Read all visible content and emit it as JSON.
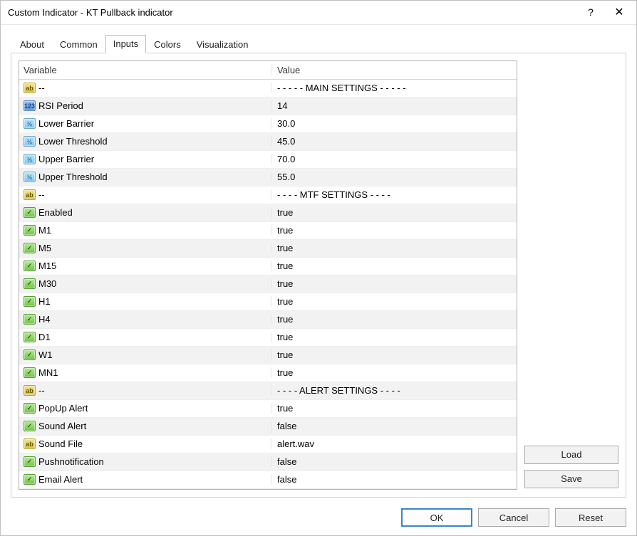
{
  "window": {
    "title": "Custom Indicator - KT Pullback indicator"
  },
  "tabs": [
    "About",
    "Common",
    "Inputs",
    "Colors",
    "Visualization"
  ],
  "active_tab": "Inputs",
  "columns": {
    "variable": "Variable",
    "value": "Value"
  },
  "sidebar": {
    "load": "Load",
    "save": "Save"
  },
  "footer": {
    "ok": "OK",
    "cancel": "Cancel",
    "reset": "Reset"
  },
  "iconLabels": {
    "text": "ab",
    "int": "123",
    "dbl": "½",
    "bool": "✓"
  },
  "rows": [
    {
      "icon": "text",
      "variable": "--",
      "value": "- - - - - MAIN SETTINGS - - - - -",
      "shade": "plain"
    },
    {
      "icon": "int",
      "variable": "RSI Period",
      "value": "14",
      "shade": "striped"
    },
    {
      "icon": "dbl",
      "variable": "Lower Barrier",
      "value": "30.0",
      "shade": "plain"
    },
    {
      "icon": "dbl",
      "variable": "Lower Threshold",
      "value": "45.0",
      "shade": "striped"
    },
    {
      "icon": "dbl",
      "variable": "Upper Barrier",
      "value": "70.0",
      "shade": "plain"
    },
    {
      "icon": "dbl",
      "variable": "Upper Threshold",
      "value": "55.0",
      "shade": "striped"
    },
    {
      "icon": "text",
      "variable": "--",
      "value": "- - - - MTF SETTINGS - - - -",
      "shade": "plain"
    },
    {
      "icon": "bool",
      "variable": "Enabled",
      "value": "true",
      "shade": "striped"
    },
    {
      "icon": "bool",
      "variable": "M1",
      "value": "true",
      "shade": "plain"
    },
    {
      "icon": "bool",
      "variable": "M5",
      "value": "true",
      "shade": "striped"
    },
    {
      "icon": "bool",
      "variable": "M15",
      "value": "true",
      "shade": "plain"
    },
    {
      "icon": "bool",
      "variable": "M30",
      "value": "true",
      "shade": "striped"
    },
    {
      "icon": "bool",
      "variable": "H1",
      "value": "true",
      "shade": "plain"
    },
    {
      "icon": "bool",
      "variable": "H4",
      "value": "true",
      "shade": "striped"
    },
    {
      "icon": "bool",
      "variable": "D1",
      "value": "true",
      "shade": "plain"
    },
    {
      "icon": "bool",
      "variable": "W1",
      "value": "true",
      "shade": "striped"
    },
    {
      "icon": "bool",
      "variable": "MN1",
      "value": "true",
      "shade": "plain"
    },
    {
      "icon": "text",
      "variable": "--",
      "value": "- - - - ALERT SETTINGS - - - -",
      "shade": "striped"
    },
    {
      "icon": "bool",
      "variable": "PopUp Alert",
      "value": "true",
      "shade": "plain"
    },
    {
      "icon": "bool",
      "variable": "Sound Alert",
      "value": "false",
      "shade": "striped"
    },
    {
      "icon": "text",
      "variable": "Sound File",
      "value": "alert.wav",
      "shade": "plain"
    },
    {
      "icon": "bool",
      "variable": "Pushnotification",
      "value": "false",
      "shade": "striped"
    },
    {
      "icon": "bool",
      "variable": "Email Alert",
      "value": "false",
      "shade": "plain"
    }
  ]
}
